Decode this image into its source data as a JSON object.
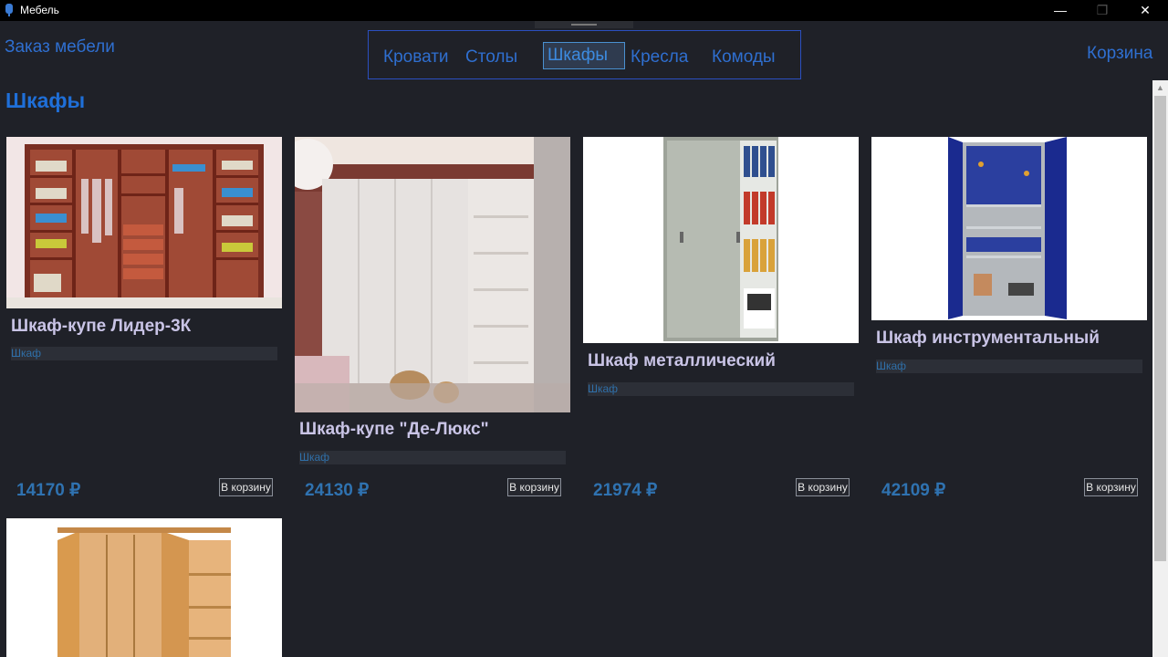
{
  "window": {
    "title": "Мебель",
    "min_glyph": "—",
    "max_glyph": "❐",
    "close_glyph": "✕"
  },
  "header": {
    "brand": "Заказ мебели",
    "nav": [
      "Кровати",
      "Столы",
      "Шкафы",
      "Кресла",
      "Комоды"
    ],
    "active_nav": "Шкафы",
    "cart": "Корзина"
  },
  "section_title": "Шкафы",
  "products": [
    {
      "name": "Шкаф-купе Лидер-3К",
      "type": "Шкаф",
      "price": "14170 ₽",
      "button": "В корзину"
    },
    {
      "name": "Шкаф-купе \"Де-Люкс\"",
      "type": "Шкаф",
      "price": "24130 ₽",
      "button": "В корзину"
    },
    {
      "name": "Шкаф металлический",
      "type": "Шкаф",
      "price": "21974 ₽",
      "button": "В корзину"
    },
    {
      "name": "Шкаф инструментальный",
      "type": "Шкаф",
      "price": "42109 ₽",
      "button": "В корзину"
    }
  ],
  "colors": {
    "background": "#1f2128",
    "accent": "#2f6fd0",
    "title": "#1f6fd8",
    "product_name": "#c9c4e6",
    "price": "#2f72b0"
  }
}
